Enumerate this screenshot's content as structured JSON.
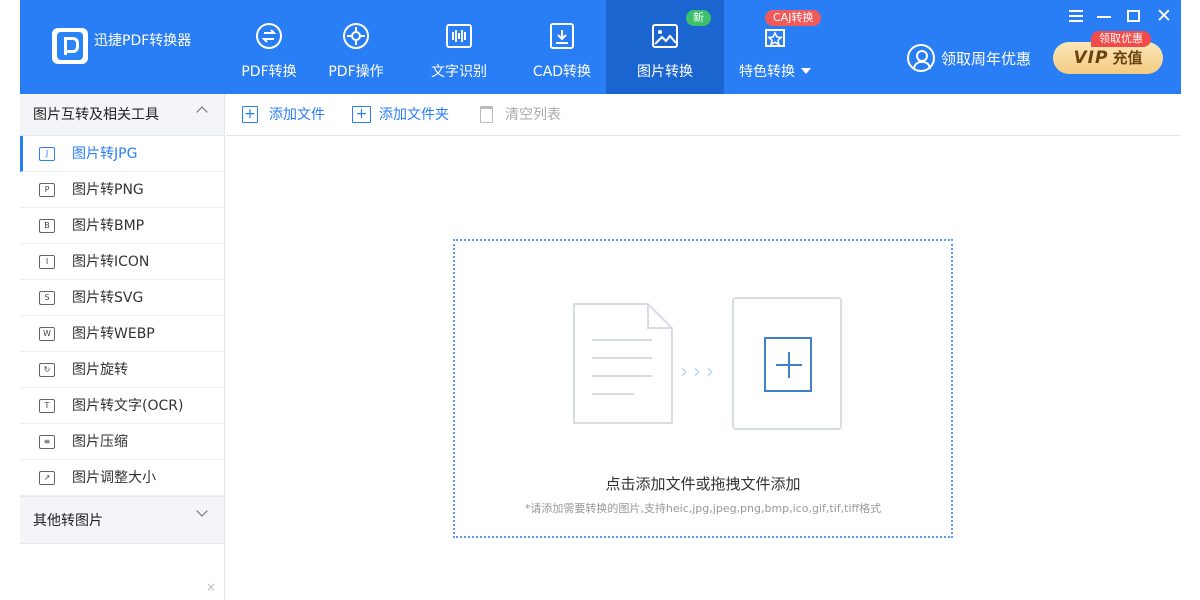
{
  "app": {
    "title": "迅捷PDF转换器"
  },
  "nav": [
    {
      "label": "PDF转换",
      "icon": "convert-icon"
    },
    {
      "label": "PDF操作",
      "icon": "gear-icon"
    },
    {
      "label": "文字识别",
      "icon": "ocr-icon"
    },
    {
      "label": "CAD转换",
      "icon": "cad-icon"
    },
    {
      "label": "图片转换",
      "icon": "image-icon",
      "active": true,
      "badge": "新"
    },
    {
      "label": "特色转换",
      "icon": "star-icon",
      "badge": "CAJ转换",
      "has_dropdown": true
    }
  ],
  "promo": {
    "label": "领取周年优惠"
  },
  "vip": {
    "label": "VIP",
    "sub": "充值",
    "badge": "领取优惠"
  },
  "window": {
    "close_glyph": "✕"
  },
  "sidebar": {
    "group1": {
      "title": "图片互转及相关工具",
      "expanded": true
    },
    "items": [
      {
        "label": "图片转JPG",
        "icon_letter": "J",
        "active": true
      },
      {
        "label": "图片转PNG",
        "icon_letter": "P"
      },
      {
        "label": "图片转BMP",
        "icon_letter": "B"
      },
      {
        "label": "图片转ICON",
        "icon_letter": "I"
      },
      {
        "label": "图片转SVG",
        "icon_letter": "S"
      },
      {
        "label": "图片转WEBP",
        "icon_letter": "W"
      },
      {
        "label": "图片旋转",
        "icon_letter": "↻"
      },
      {
        "label": "图片转文字(OCR)",
        "icon_letter": "T"
      },
      {
        "label": "图片压缩",
        "icon_letter": "≡"
      },
      {
        "label": "图片调整大小",
        "icon_letter": "↗"
      }
    ],
    "group2": {
      "title": "其他转图片",
      "expanded": false
    },
    "close_glyph": "×"
  },
  "toolbar": {
    "add_file": "添加文件",
    "add_folder": "添加文件夹",
    "clear_list": "清空列表"
  },
  "dropzone": {
    "title": "点击添加文件或拖拽文件添加",
    "hint": "*请添加需要转换的图片,支持heic,jpg,jpeg,png,bmp,ico,gif,tif,tiff格式",
    "arrows": "›››"
  },
  "colors": {
    "brand": "#2a7ef5",
    "active_nav": "#1a65cf",
    "new_badge": "#3cc06b",
    "caj_badge": "#f25a5a"
  }
}
